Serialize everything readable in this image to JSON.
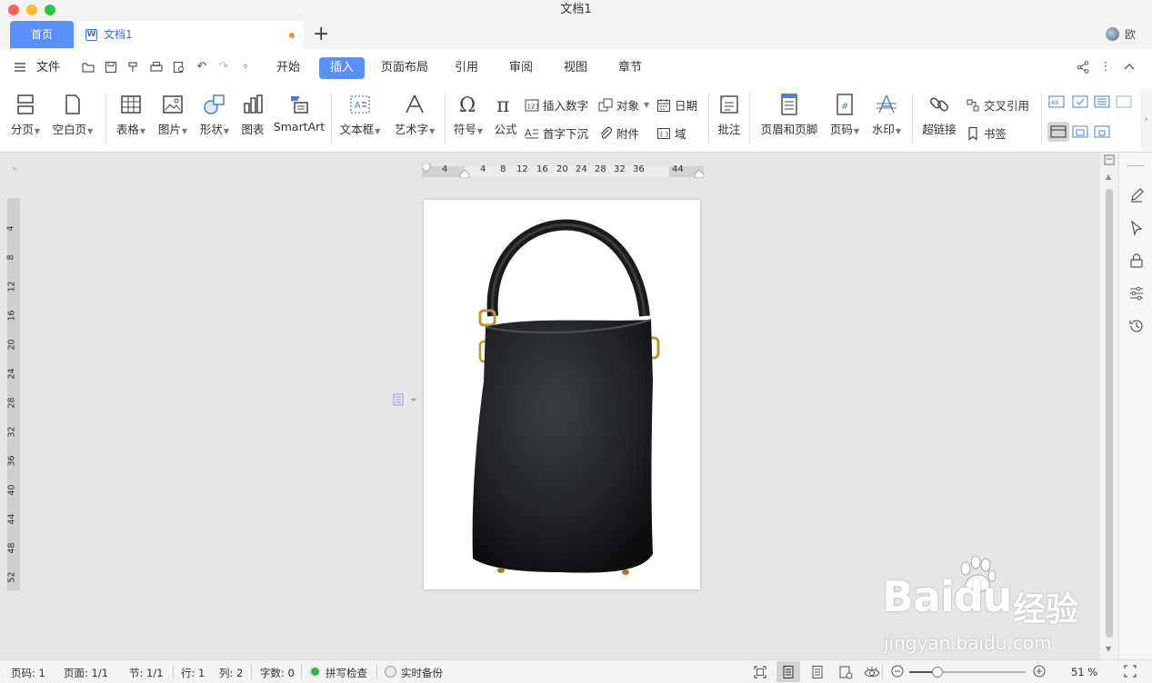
{
  "window": {
    "title": "文档1"
  },
  "tabs": {
    "home": "首页",
    "doc": "文档1",
    "add": "+",
    "user": "欧"
  },
  "menu": {
    "file": "文件",
    "items": [
      "开始",
      "插入",
      "页面布局",
      "引用",
      "审阅",
      "视图",
      "章节"
    ],
    "active": "插入"
  },
  "ribbon": {
    "page_break": "分页",
    "blank_page": "空白页",
    "table": "表格",
    "picture": "图片",
    "shape": "形状",
    "chart": "图表",
    "smartart": "SmartArt",
    "textbox": "文本框",
    "wordart": "艺术字",
    "symbol": "符号",
    "formula": "公式",
    "insert_number": "插入数字",
    "dropcap": "首字下沉",
    "object": "对象",
    "attachment": "附件",
    "date": "日期",
    "field": "域",
    "comment": "批注",
    "header_footer": "页眉和页脚",
    "page_number": "页码",
    "watermark": "水印",
    "hyperlink": "超链接",
    "cross_ref": "交叉引用",
    "bookmark": "书签"
  },
  "ruler": {
    "h_ticks": [
      "4",
      "4",
      "8",
      "12",
      "16",
      "20",
      "24",
      "28",
      "32",
      "36",
      "44"
    ],
    "v_ticks": [
      "4",
      "8",
      "12",
      "16",
      "20",
      "24",
      "28",
      "32",
      "36",
      "40",
      "44",
      "48",
      "52"
    ]
  },
  "status": {
    "page_code": "页码: 1",
    "pages": "页面: 1/1",
    "section": "节: 1/1",
    "row": "行: 1",
    "col": "列: 2",
    "word_count": "字数: 0",
    "spell_check": "拼写检查",
    "backup": "实时备份",
    "zoom": "51 %"
  },
  "watermark": {
    "brand": "Baidu",
    "cn": "经验",
    "url": "jingyan.baidu.com"
  },
  "colors": {
    "accent": "#5b8ff9",
    "status_ok": "#3fae49"
  }
}
